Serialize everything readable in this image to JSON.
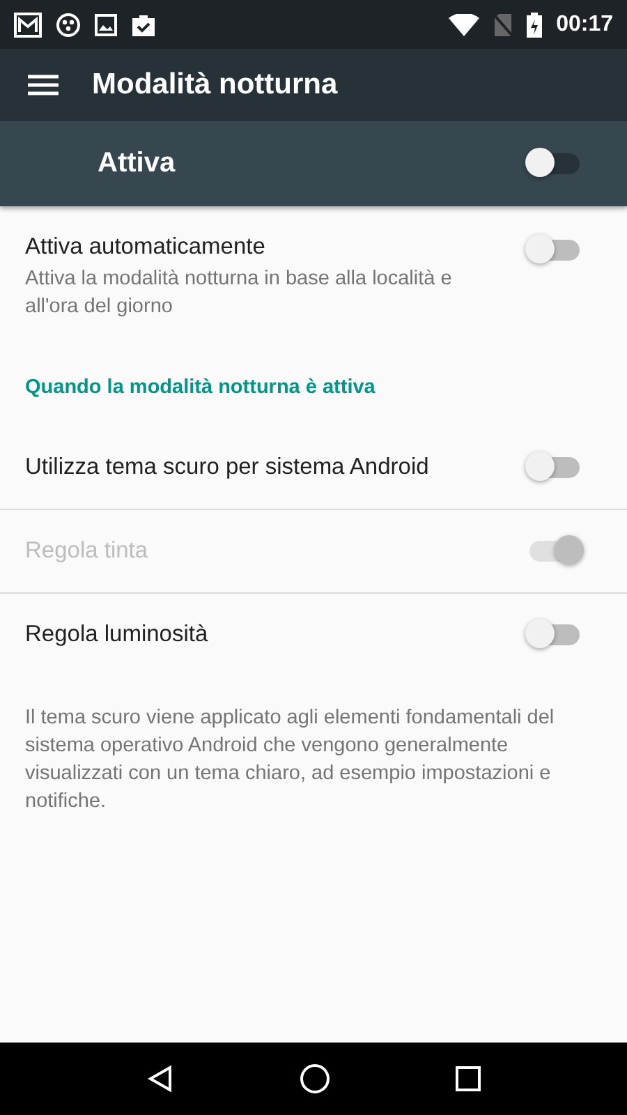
{
  "status_bar": {
    "time": "00:17"
  },
  "app_bar": {
    "title": "Modalità notturna"
  },
  "master_switch": {
    "label": "Attiva",
    "on": false
  },
  "settings": [
    {
      "kind": "switch",
      "title": "Attiva automaticamente",
      "summary": "Attiva la modalità notturna in base alla località e all'ora del giorno",
      "on": false,
      "disabled": false,
      "divider": false
    },
    {
      "kind": "header",
      "title": "Quando la modalità notturna è attiva"
    },
    {
      "kind": "switch",
      "title": "Utilizza tema scuro per sistema Android",
      "on": false,
      "disabled": false,
      "divider": true
    },
    {
      "kind": "switch",
      "title": "Regola tinta",
      "on": true,
      "disabled": true,
      "divider": true
    },
    {
      "kind": "switch",
      "title": "Regola luminosità",
      "on": false,
      "disabled": false,
      "divider": false
    },
    {
      "kind": "footer",
      "title": "Il tema scuro viene applicato agli elementi fondamentali del sistema operativo Android che vengono generalmente visualizzati con un tema chiaro, ad esempio impostazioni e notifiche."
    }
  ]
}
